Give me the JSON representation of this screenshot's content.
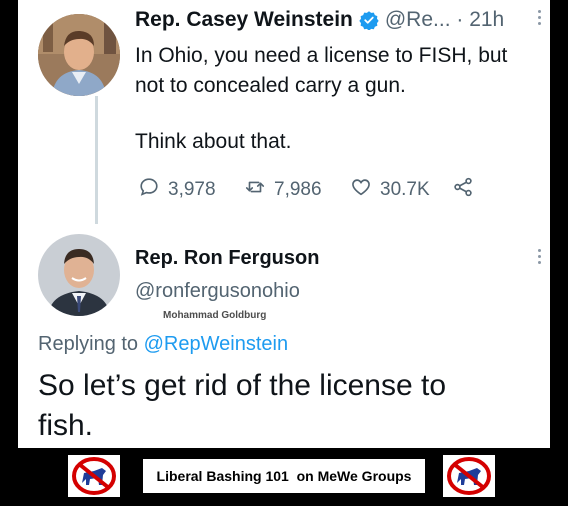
{
  "tweet1": {
    "name": "Rep. Casey Weinstein",
    "handle_time": "@Re... · 21h",
    "line1": "In Ohio, you need a license to FISH, but",
    "line2": "not to concealed carry a gun.",
    "line3": "Think about that.",
    "replies": "3,978",
    "retweets": "7,986",
    "likes": "30.7K"
  },
  "tweet2": {
    "name": "Rep. Ron Ferguson",
    "handle": "@ronfergusonohio",
    "watermark": "Mohammad Goldburg",
    "replying_prefix": "Replying to ",
    "replying_handle": "@RepWeinstein",
    "body_line1": "So let’s get rid of the license to",
    "body_line2": "fish."
  },
  "footer": {
    "label": "Liberal Bashing 101  on MeWe Groups"
  },
  "colors": {
    "verified": "#1d9bf0",
    "link": "#1d9bf0",
    "no_symbol": "#d40000",
    "donkey": "#1f3d99"
  }
}
